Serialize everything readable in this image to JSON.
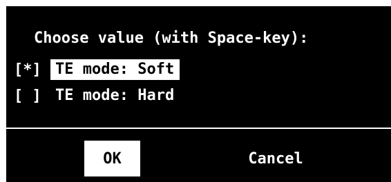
{
  "dialog": {
    "prompt": "Choose value (with Space-key):",
    "options": [
      {
        "mark": "[*]",
        "label": "TE mode: Soft",
        "checked": true
      },
      {
        "mark": "[ ]",
        "label": "TE mode: Hard",
        "checked": false
      }
    ],
    "buttons": {
      "ok_label": "OK",
      "cancel_label": "Cancel"
    }
  },
  "colors": {
    "background": "#000000",
    "foreground": "#ffffff",
    "highlight_bg": "#ffffff",
    "highlight_fg": "#000000"
  }
}
